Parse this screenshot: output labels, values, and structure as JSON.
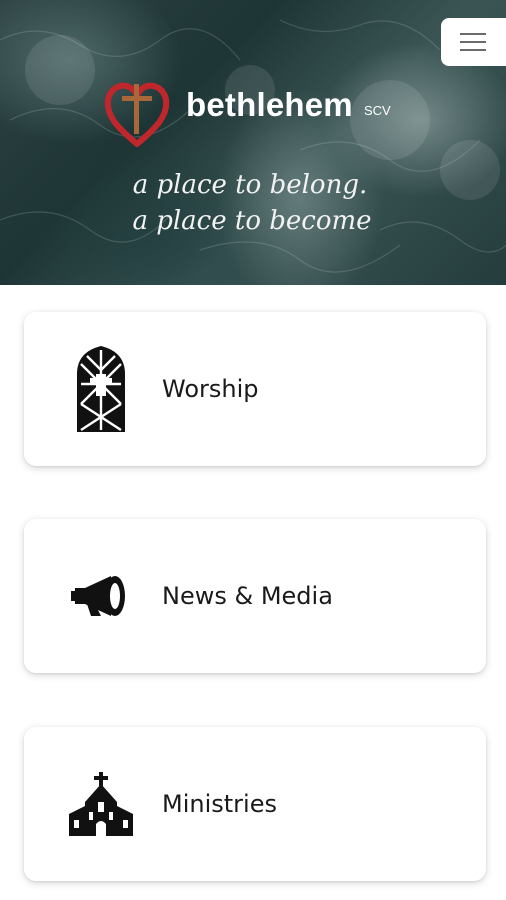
{
  "header": {
    "brand_name": "bethlehem",
    "brand_suffix": "SCV",
    "tagline_line1": "a place to belong.",
    "tagline_line2": "a place to become",
    "menu_icon": "hamburger-menu-icon",
    "accent_color": "#c0272d",
    "cross_color": "#a8683a"
  },
  "menu": [
    {
      "label": "Worship",
      "icon": "stained-glass-window-icon"
    },
    {
      "label": "News & Media",
      "icon": "megaphone-icon"
    },
    {
      "label": "Ministries",
      "icon": "church-icon"
    }
  ]
}
